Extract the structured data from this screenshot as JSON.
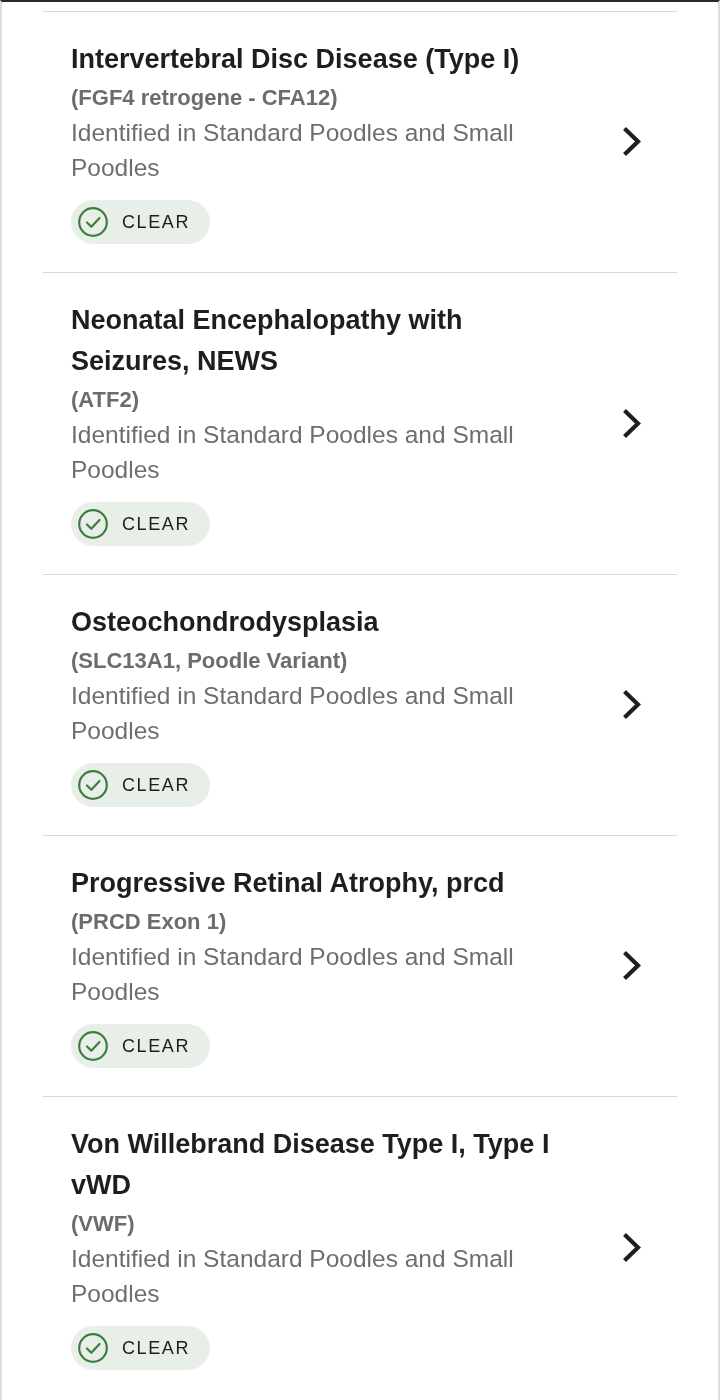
{
  "results": [
    {
      "title": "Intervertebral Disc Disease (Type I)",
      "gene": "(FGF4 retrogene - CFA12)",
      "description": "Identified in Standard Poodles and Small Poodles",
      "status": {
        "kind": "clear",
        "label": "CLEAR"
      }
    },
    {
      "title": "Neonatal Encephalopathy with Seizures, NEWS",
      "gene": "(ATF2)",
      "description": "Identified in Standard Poodles and Small Poodles",
      "status": {
        "kind": "clear",
        "label": "CLEAR"
      }
    },
    {
      "title": "Osteochondrodysplasia",
      "gene": "(SLC13A1, Poodle Variant)",
      "description": "Identified in Standard Poodles and Small Poodles",
      "status": {
        "kind": "clear",
        "label": "CLEAR"
      }
    },
    {
      "title": "Progressive Retinal Atrophy, prcd",
      "gene": "(PRCD Exon 1)",
      "description": "Identified in Standard Poodles and Small Poodles",
      "status": {
        "kind": "clear",
        "label": "CLEAR"
      }
    },
    {
      "title": "Von Willebrand Disease Type I, Type I vWD",
      "gene": "(VWF)",
      "description": "Identified in Standard Poodles and Small Poodles",
      "status": {
        "kind": "clear",
        "label": "CLEAR"
      }
    }
  ]
}
